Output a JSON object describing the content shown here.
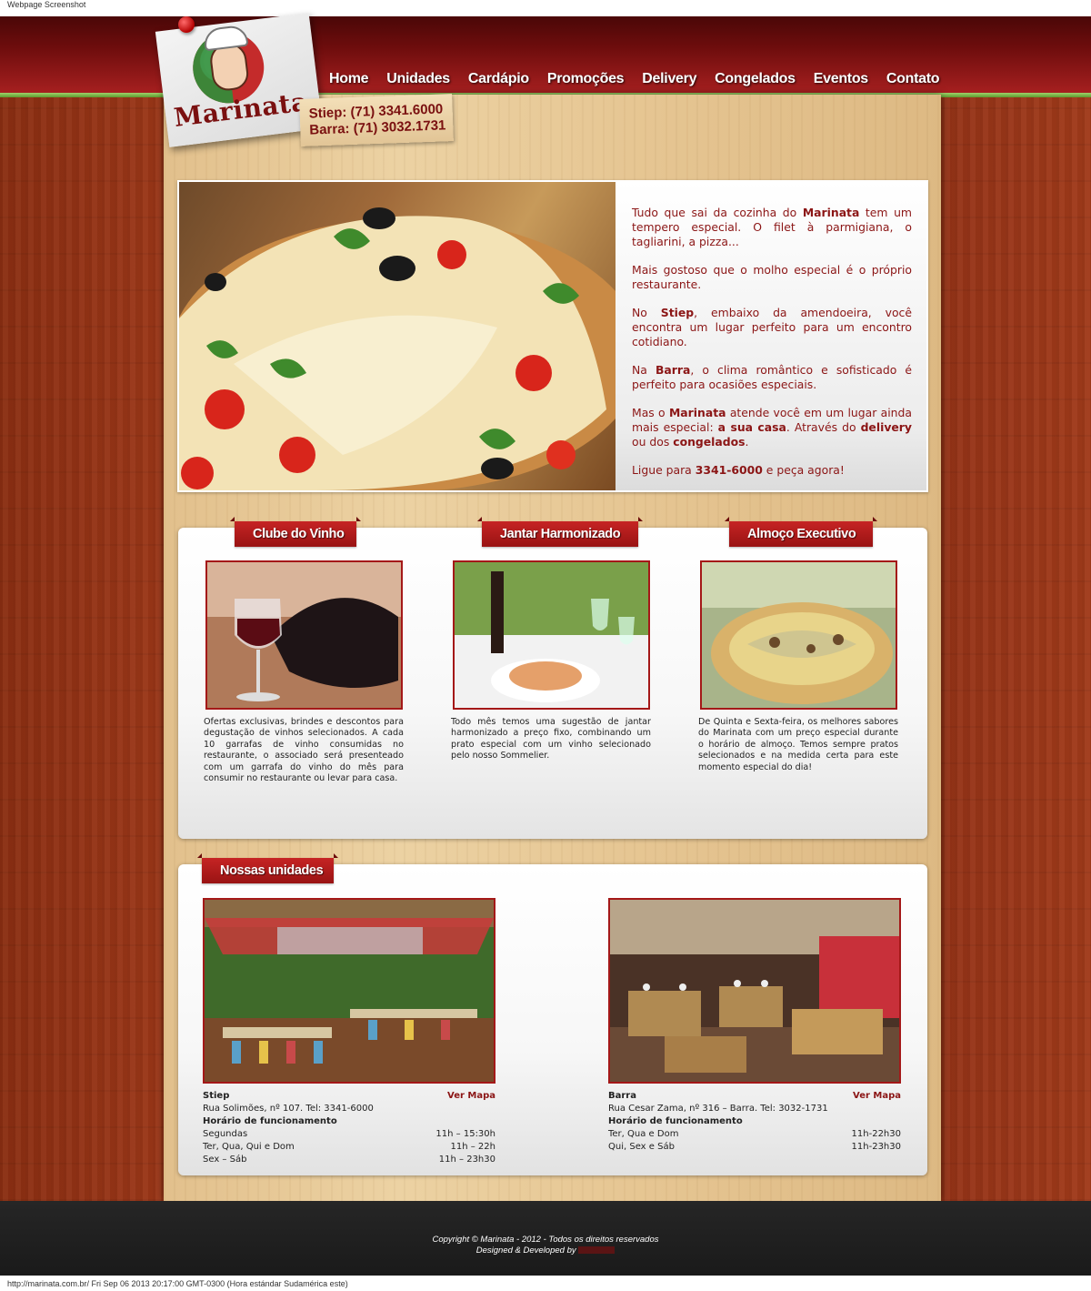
{
  "page_caption": "Webpage Screenshot",
  "logo": {
    "text": "Marinata"
  },
  "phones": [
    "Stiep:  (71) 3341.6000",
    "Barra: (71) 3032.1731"
  ],
  "nav": [
    "Home",
    "Unidades",
    "Cardápio",
    "Promoções",
    "Delivery",
    "Congelados",
    "Eventos",
    "Contato"
  ],
  "hero": {
    "p1a": "Tudo que sai da cozinha do ",
    "p1b": "Marinata",
    "p1c": " tem um tempero especial. O filet à parmigiana, o tagliarini, a pizza...",
    "p2": "Mais gostoso que o molho especial é o próprio restaurante.",
    "p3a": "No ",
    "p3b": "Stiep",
    "p3c": ", embaixo da amendoeira, você encontra um lugar perfeito para um encontro cotidiano.",
    "p4a": "Na ",
    "p4b": "Barra",
    "p4c": ", o clima romântico e sofisticado é perfeito para ocasiões especiais.",
    "p5a": "Mas o ",
    "p5b": "Marinata",
    "p5c": " atende você em um lugar ainda mais especial: ",
    "p5d": "a sua casa",
    "p5e": ". Através do ",
    "p5f": "delivery",
    "p5g": " ou dos ",
    "p5h": "congelados",
    "p5i": ".",
    "p6a": "Ligue para ",
    "p6b": "3341-6000",
    "p6c": " e peça agora!"
  },
  "features": [
    {
      "title": "Clube do Vinho",
      "text": "Ofertas exclusivas, brindes e descontos para degustação de vinhos selecionados. A cada 10 garrafas de vinho consumidas no restaurante, o associado será presenteado com um garrafa do vinho do mês para consumir no restaurante ou levar para casa."
    },
    {
      "title": "Jantar Harmonizado",
      "text": "Todo mês temos uma sugestão de jantar harmonizado a preço fixo, combinando um prato especial com um vinho selecionado pelo nosso Sommelier."
    },
    {
      "title": "Almoço Executivo",
      "text": "De Quinta e Sexta-feira, os melhores sabores do Marinata com um preço especial durante o horário de almoço. Temos sempre pratos selecionados e na medida certa para este momento especial do dia!"
    }
  ],
  "units_title": "Nossas unidades",
  "units": [
    {
      "name": "Stiep",
      "map": "Ver Mapa",
      "address": "Rua Solimões, nº 107. Tel: 3341-6000",
      "hours_title": "Horário de funcionamento",
      "hours": [
        {
          "days": "Segundas",
          "time": "11h – 15:30h"
        },
        {
          "days": "Ter, Qua, Qui e Dom",
          "time": "11h – 22h"
        },
        {
          "days": "Sex – Sáb",
          "time": "11h – 23h30"
        }
      ]
    },
    {
      "name": "Barra",
      "map": "Ver Mapa",
      "address": "Rua Cesar Zama, nº 316 – Barra. Tel: 3032-1731",
      "hours_title": "Horário de funcionamento",
      "hours": [
        {
          "days": "Ter, Qua e Dom",
          "time": "11h-22h30"
        },
        {
          "days": "Qui, Sex e Sáb",
          "time": "11h-23h30"
        }
      ]
    }
  ],
  "footer": {
    "copyright": "Copyright © Marinata - 2012 - Todos os direitos reservados",
    "developed": "Designed & Developed by"
  },
  "bottom_caption": "http://marinata.com.br/ Fri Sep 06 2013 20:17:00 GMT-0300 (Hora estándar Sudamérica este)",
  "colors": {
    "brand_red": "#8b1515",
    "header_dark": "#4a0707",
    "accent_green": "#5d9a2e",
    "wood": "#a13a1a",
    "panel": "#e6c693"
  }
}
